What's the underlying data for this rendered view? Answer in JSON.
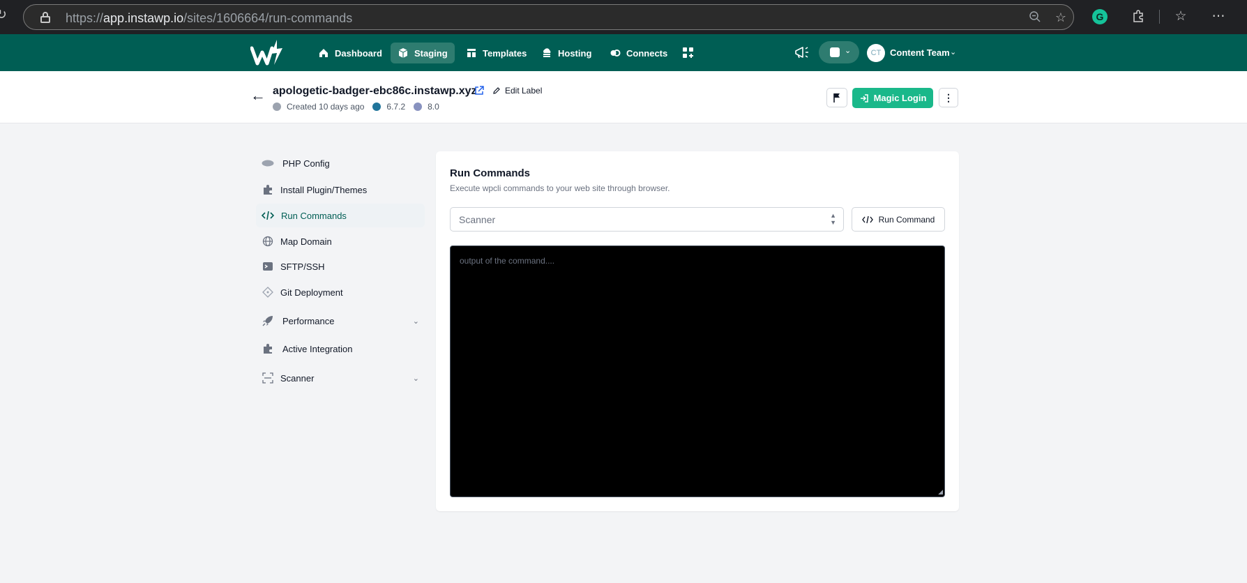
{
  "browser": {
    "url_scheme": "https://",
    "url_host": "app.instawp.io",
    "url_path": "/sites/1606664/run-commands",
    "icons": [
      "reload-icon",
      "lock-icon",
      "zoom-out-icon",
      "favorite-star-icon",
      "grammarly-icon",
      "extensions-icon",
      "favorites-bar-icon",
      "more-icon"
    ]
  },
  "nav": {
    "items": [
      {
        "label": "Dashboard",
        "icon": "home-icon"
      },
      {
        "label": "Staging",
        "icon": "cube-icon"
      },
      {
        "label": "Templates",
        "icon": "template-icon"
      },
      {
        "label": "Hosting",
        "icon": "cloud-server-icon"
      },
      {
        "label": "Connects",
        "icon": "link-icon"
      }
    ],
    "active": "Staging",
    "avatar_initials": "CT",
    "user_name": "Content Team"
  },
  "site": {
    "name": "apologetic-badger-ebc86c.instawp.xyz",
    "edit_label": "Edit Label",
    "created": "Created 10 days ago",
    "wp_version": "6.7.2",
    "php_version": "8.0",
    "magic_login": "Magic Login"
  },
  "sidebar": {
    "items": [
      {
        "label": "PHP Config",
        "icon": "php-icon"
      },
      {
        "label": "Install Plugin/Themes",
        "icon": "puzzle-icon"
      },
      {
        "label": "Run Commands",
        "icon": "code-icon",
        "active": true
      },
      {
        "label": "Map Domain",
        "icon": "globe-icon"
      },
      {
        "label": "SFTP/SSH",
        "icon": "terminal-icon"
      },
      {
        "label": "Git Deployment",
        "icon": "git-icon"
      },
      {
        "label": "Performance",
        "icon": "rocket-icon",
        "expandable": true
      },
      {
        "label": "Active Integration",
        "icon": "puzzle-icon"
      },
      {
        "label": "Scanner",
        "icon": "scan-icon",
        "expandable": true
      }
    ]
  },
  "main": {
    "title": "Run Commands",
    "subtitle": "Execute wpcli commands to your web site through browser.",
    "select_value": "Scanner",
    "run_button": "Run Command",
    "output_placeholder": "output of the command...."
  },
  "colors": {
    "brand": "#005e54",
    "accent": "#1ab88a",
    "terminal_bg": "#000000"
  }
}
